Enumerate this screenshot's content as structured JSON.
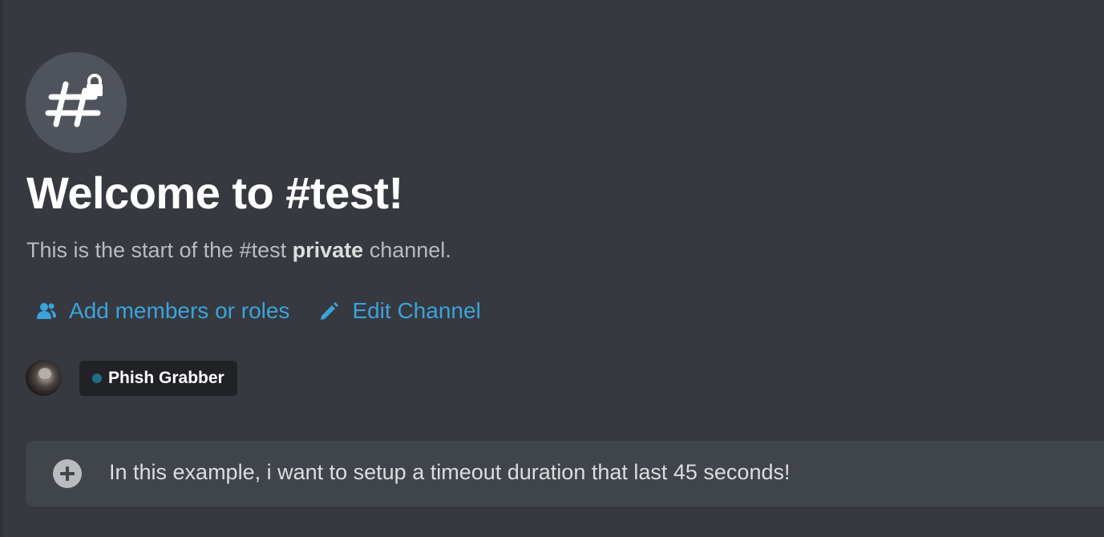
{
  "channel": {
    "icon": "hashtag-lock-icon",
    "welcome_title": "Welcome to #test!",
    "subtitle_prefix": "This is the start of the #test ",
    "subtitle_bold": "private",
    "subtitle_suffix": " channel."
  },
  "actions": [
    {
      "label": "Add members or roles",
      "icon": "add-members-icon"
    },
    {
      "label": "Edit Channel",
      "icon": "pencil-icon"
    }
  ],
  "member": {
    "name": "Phish Grabber",
    "role_color": "#216d83"
  },
  "composer": {
    "value": "In this example, i want to setup a timeout duration that last 45 seconds!",
    "attach_icon": "plus-circle-icon"
  },
  "colors": {
    "background": "#36393f",
    "link": "#3ba3db",
    "composer_bg": "#40444b"
  }
}
